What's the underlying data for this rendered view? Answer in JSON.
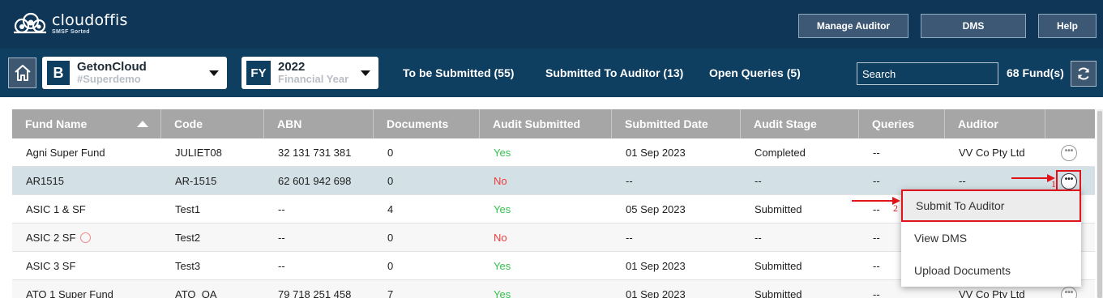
{
  "app": {
    "name": "cloudoffis",
    "tagline": "SMSF Sorted"
  },
  "header": {
    "buttons": {
      "manage_auditor": "Manage Auditor",
      "dms": "DMS",
      "help": "Help"
    }
  },
  "nav": {
    "client": {
      "badge": "B",
      "name": "GetonCloud",
      "sub": "#Superdemo"
    },
    "year": {
      "badge": "FY",
      "value": "2022",
      "sub": "Financial Year"
    },
    "links": {
      "to_be_submitted": "To be Submitted (55)",
      "submitted_to_auditor": "Submitted To Auditor (13)",
      "open_queries": "Open Queries (5)"
    },
    "search": {
      "placeholder": "Search"
    },
    "fund_count": "68 Fund(s)"
  },
  "table": {
    "columns": [
      "Fund Name",
      "Code",
      "ABN",
      "Documents",
      "Audit Submitted",
      "Submitted Date",
      "Audit Stage",
      "Queries",
      "Auditor"
    ],
    "rows": [
      {
        "fund": "Agni Super Fund",
        "code": "JULIET08",
        "abn": "32 131 731 381",
        "docs": "0",
        "submitted": "Yes",
        "date": "01 Sep 2023",
        "stage": "Completed",
        "queries": "--",
        "auditor": "VV Co Pty Ltd"
      },
      {
        "fund": "AR1515",
        "code": "AR-1515",
        "abn": "62 601 942 698",
        "docs": "0",
        "submitted": "No",
        "date": "--",
        "stage": "--",
        "queries": "--",
        "auditor": "--"
      },
      {
        "fund": "ASIC 1 & SF",
        "code": "Test1",
        "abn": "--",
        "docs": "4",
        "submitted": "Yes",
        "date": "05 Sep 2023",
        "stage": "Submitted",
        "queries": "--",
        "auditor": ""
      },
      {
        "fund": "ASIC 2 SF",
        "code": "Test2",
        "abn": "--",
        "docs": "0",
        "submitted": "No",
        "date": "--",
        "stage": "--",
        "queries": "--",
        "auditor": ""
      },
      {
        "fund": "ASIC 3 SF",
        "code": "Test3",
        "abn": "--",
        "docs": "0",
        "submitted": "Yes",
        "date": "01 Sep 2023",
        "stage": "Submitted",
        "queries": "--",
        "auditor": ""
      },
      {
        "fund": "ATO 1 Super Fund",
        "code": "ATO_OA",
        "abn": "79 718 251 458",
        "docs": "7",
        "submitted": "Yes",
        "date": "01 Sep 2023",
        "stage": "Submitted",
        "queries": "--",
        "auditor": "VV Co Pty Ltd"
      }
    ]
  },
  "menu": {
    "items": [
      "Submit To Auditor",
      "View DMS",
      "Upload Documents"
    ]
  },
  "annotations": {
    "step1": "1",
    "step2": "2"
  },
  "colors": {
    "header_bg": "#0f3657",
    "nav_bg": "#0e3e60",
    "yes": "#33c24d",
    "no": "#f23b3b",
    "highlight": "#e0151b"
  }
}
